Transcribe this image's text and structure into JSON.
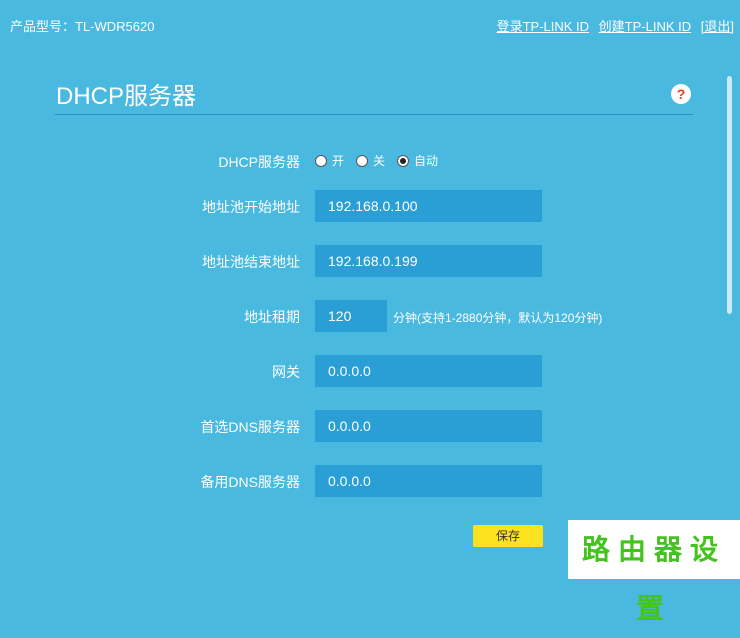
{
  "header": {
    "product_model": "产品型号：TL-WDR5620",
    "links": {
      "login": "登录TP-LINK ID",
      "create": "创建TP-LINK ID",
      "logout": "[退出]"
    }
  },
  "page": {
    "title": "DHCP服务器",
    "help": "?"
  },
  "form": {
    "dhcp_server": {
      "label": "DHCP服务器",
      "options": [
        "开",
        "关",
        "自动"
      ],
      "selected": "自动"
    },
    "pool_start": {
      "label": "地址池开始地址",
      "value": "192.168.0.100"
    },
    "pool_end": {
      "label": "地址池结束地址",
      "value": "192.168.0.199"
    },
    "lease": {
      "label": "地址租期",
      "value": "120",
      "hint": "分钟(支持1-2880分钟，默认为120分钟)"
    },
    "gateway": {
      "label": "网关",
      "value": "0.0.0.0"
    },
    "primary_dns": {
      "label": "首选DNS服务器",
      "value": "0.0.0.0"
    },
    "secondary_dns": {
      "label": "备用DNS服务器",
      "value": "0.0.0.0"
    },
    "save_label": "保存"
  },
  "watermark": "路由器设置",
  "colors": {
    "background": "#4ab9df",
    "field": "#2a9fd6",
    "save_button": "#fce21f",
    "watermark_text": "#44c21e"
  }
}
